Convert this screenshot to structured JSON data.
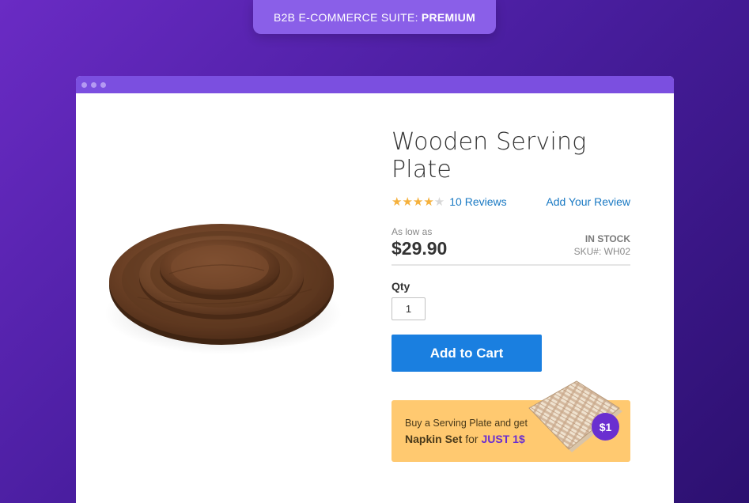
{
  "badge": {
    "prefix": "B2B E-COMMERCE SUITE:",
    "edition": "PREMIUM"
  },
  "window": {
    "dots": 3
  },
  "product": {
    "name": "Wooden Serving Plate",
    "rating_stars": 4,
    "rating_max": 5,
    "reviews_label": "10 Reviews",
    "add_review_label": "Add Your Review",
    "price_prefix": "As low as",
    "price": "$29.90",
    "stock": "IN STOCK",
    "sku_label": "SKU#:",
    "sku": "WH02",
    "qty_label": "Qty",
    "qty_value": "1",
    "add_to_cart_label": "Add to Cart"
  },
  "promo": {
    "line1": "Buy a Serving Plate and get",
    "item": "Napkin Set",
    "for": "for",
    "deal": "JUST 1$",
    "badge": "$1"
  },
  "colors": {
    "background": "#4a1ea0",
    "accent": "#7b4fe0",
    "button": "#1a7fe0",
    "link": "#1979c3",
    "promo": "#ffc970",
    "star": "#f5b13d"
  }
}
